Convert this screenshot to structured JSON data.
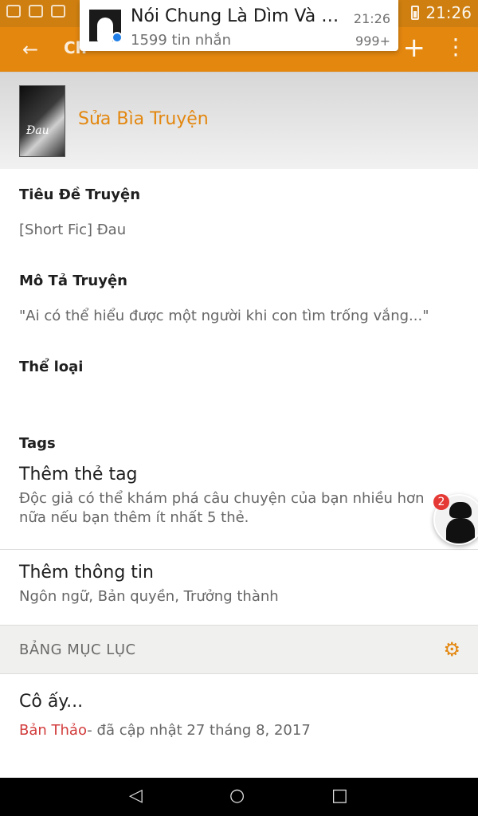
{
  "status_bar": {
    "time": "21:26"
  },
  "app_bar": {
    "title_partial": "Ch",
    "icons": [
      "back-arrow-icon",
      "plus-icon",
      "overflow-menu-icon"
    ]
  },
  "notification": {
    "title": "Nói Chung Là Dìm Và Kh..",
    "subtitle": "1599 tin nhắn",
    "time": "21:26",
    "count": "999+",
    "badge_icon": "messenger-icon"
  },
  "cover": {
    "title": "Sửa Bìa Truyện",
    "cover_text": "Đau"
  },
  "fields": {
    "story_title_label": "Tiêu Đề Truyện",
    "story_title_value": "[Short Fic] Đau",
    "description_label": "Mô Tả Truyện",
    "description_value": "\"Ai có thể hiểu được một người khi con tìm trống vắng...\"",
    "genre_label": "Thể loại",
    "tags_label": "Tags"
  },
  "tags_row": {
    "title": "Thêm thẻ tag",
    "subtitle": "Độc giả có thể khám phá câu chuyện của bạn nhiều hơn nữa nếu bạn thêm ít nhất 5 thẻ."
  },
  "info_row": {
    "title": "Thêm thông tin",
    "subtitle": "Ngôn ngữ, Bản quyền, Trưởng thành"
  },
  "toc": {
    "label": "BẢNG MỤC LỤC",
    "icon": "gear-icon"
  },
  "part": {
    "title": "Cô ấy...",
    "status": "Bản Thảo",
    "meta": "- đã cập nhật 27 tháng 8, 2017"
  },
  "chathead": {
    "badge_count": "2"
  },
  "colors": {
    "accent": "#e3870f",
    "status_bar": "#cf7f10",
    "draft_red": "#d23b3b"
  }
}
